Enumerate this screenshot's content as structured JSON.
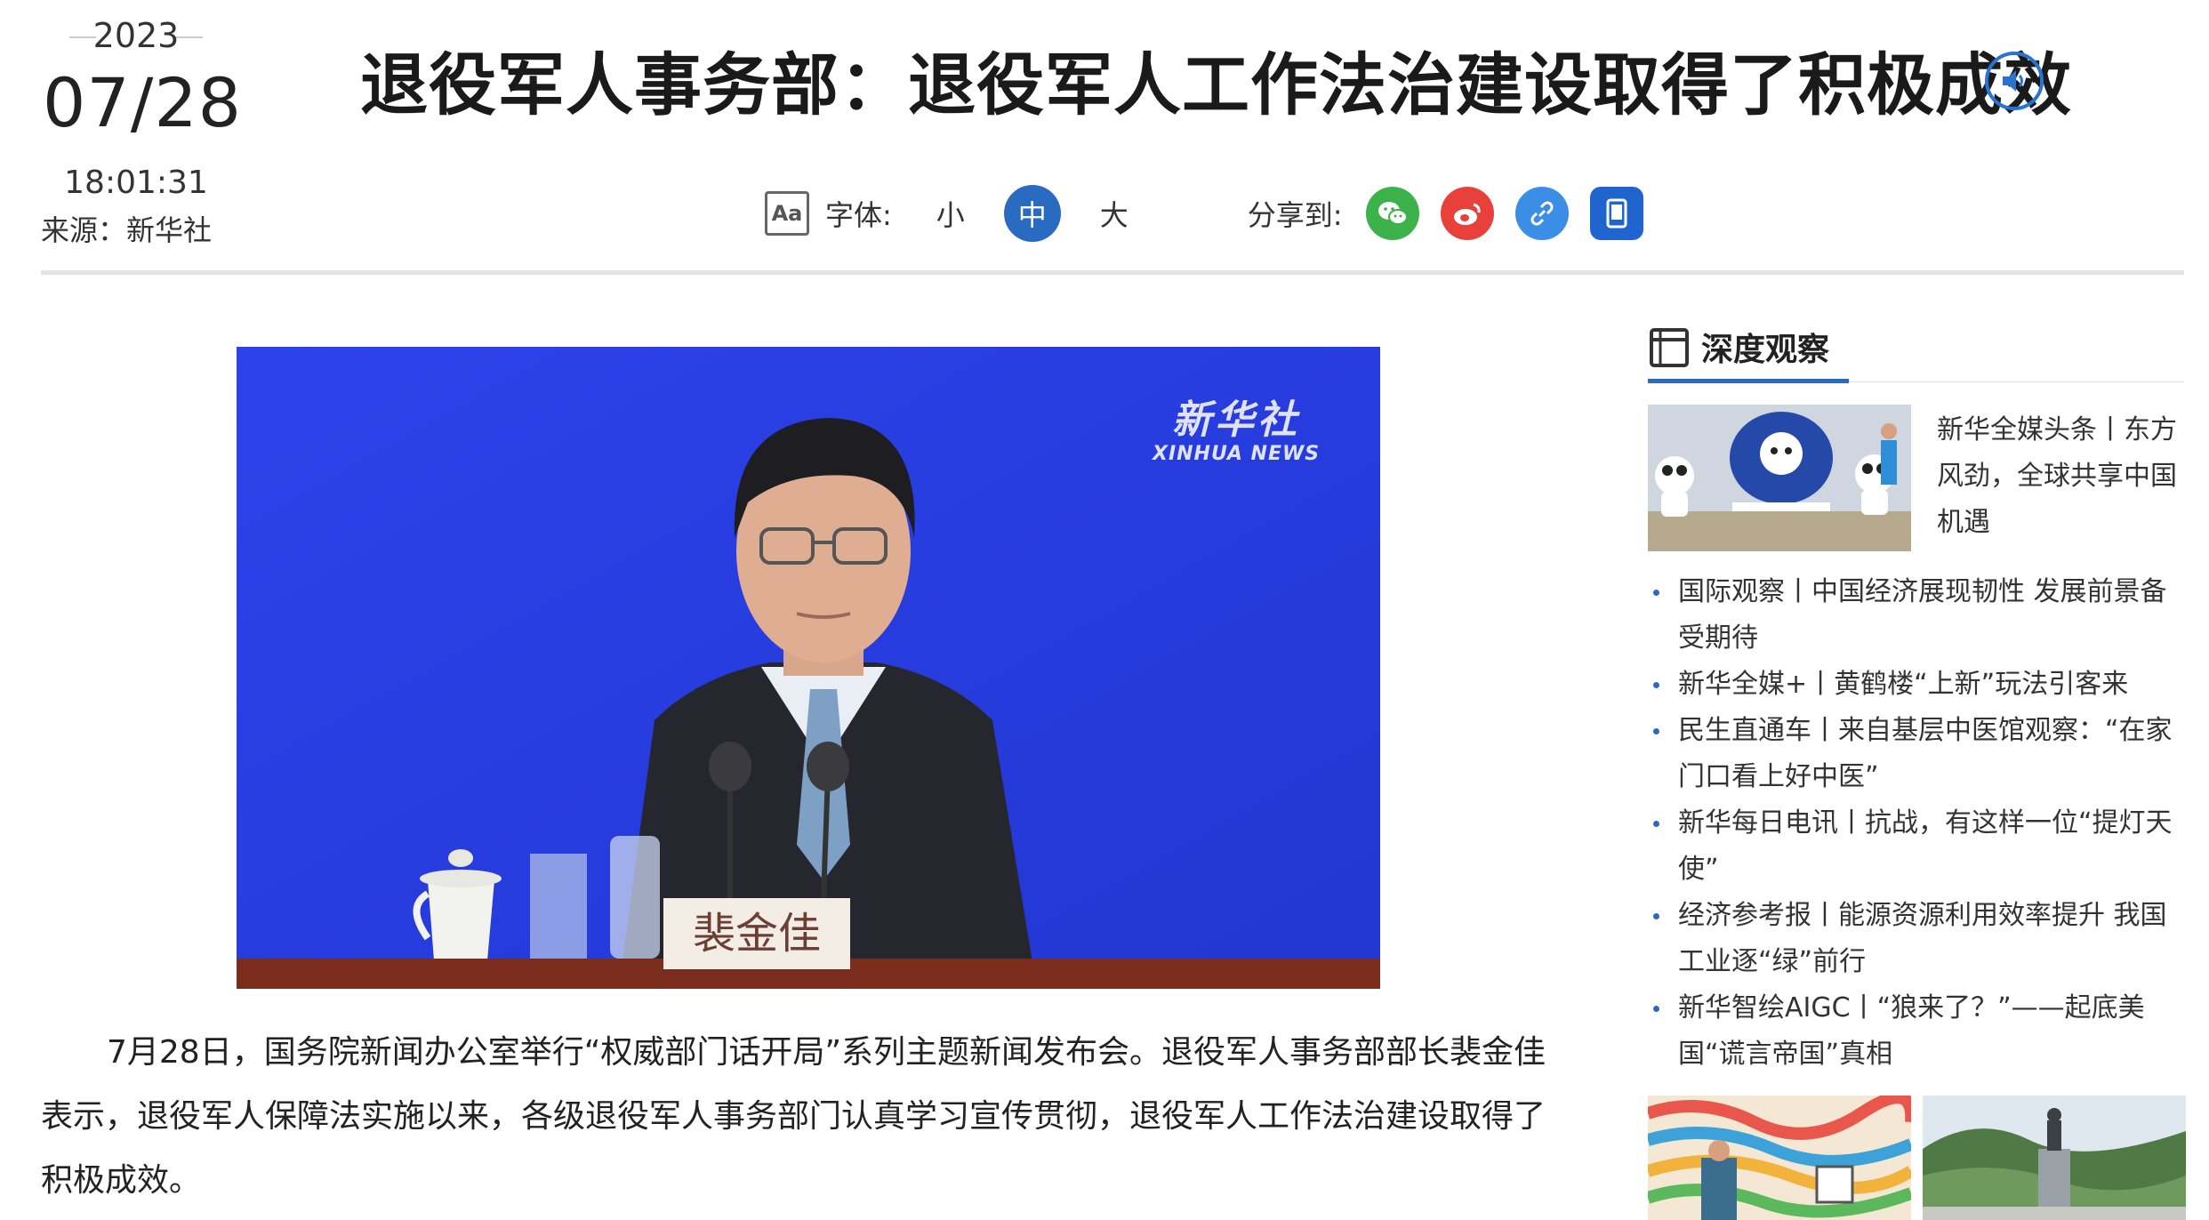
{
  "date": {
    "year": "2023",
    "month_day": "07/28",
    "time": "18:01:31"
  },
  "source": "来源：新华社",
  "title": "退役军人事务部：退役军人工作法治建设取得了积极成效",
  "toolbar": {
    "font_icon_text": "Aa",
    "font_label": "字体:",
    "sizes": [
      "小",
      "中",
      "大"
    ],
    "active_size": "中",
    "share_label": "分享到:",
    "share_buttons": [
      "wechat-icon",
      "weibo-icon",
      "link-icon",
      "mobile-icon"
    ]
  },
  "photo": {
    "watermark_cn": "新华社",
    "watermark_en": "XINHUA NEWS",
    "nameplate": "裴金佳"
  },
  "article": {
    "paragraph": "7月28日，国务院新闻办公室举行“权威部门话开局”系列主题新闻发布会。退役军人事务部部长裴金佳表示，退役军人保障法实施以来，各级退役军人事务部门认真学习宣传贯彻，退役军人工作法治建设取得了积极成效。"
  },
  "sidebar": {
    "heading": "深度观察",
    "top_story": "新华全媒头条丨东方风劲，全球共享中国机遇",
    "items": [
      "国际观察丨中国经济展现韧性 发展前景备受期待",
      "新华全媒+丨黄鹤楼“上新”玩法引客来",
      "民生直通车丨来自基层中医馆观察：“在家门口看上好中医”",
      "新华每日电讯丨抗战，有这样一位“提灯天使”",
      "经济参考报丨能源资源利用效率提升 我国工业逐“绿”前行",
      "新华智绘AIGC丨“狼来了？”——起底美国“谎言帝国”真相"
    ]
  },
  "colors": {
    "accent": "#2a6bc2",
    "photo_bg": "#2b3ee0",
    "wechat": "#3bb24a",
    "weibo": "#e8413c",
    "link": "#3a8ee6",
    "mobile": "#2064d0"
  }
}
